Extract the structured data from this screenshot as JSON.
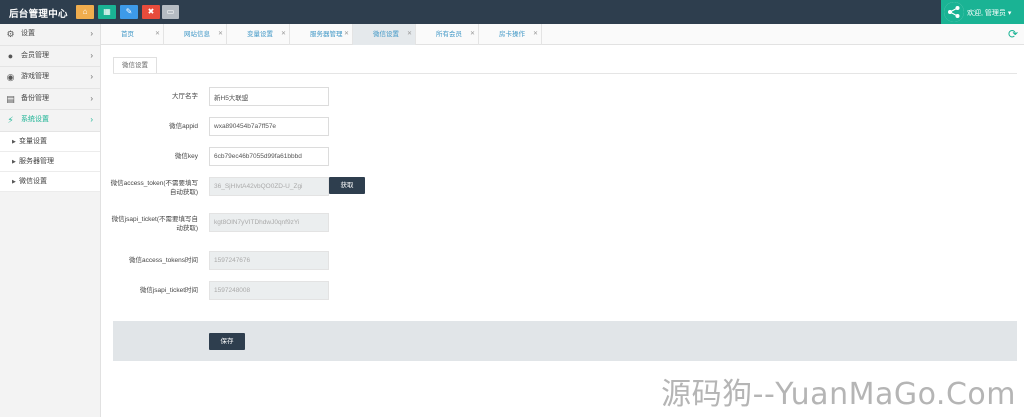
{
  "app": {
    "title": "后台管理中心"
  },
  "toolbar": [
    {
      "icon": "home-icon",
      "glyph": "⌂",
      "color": "#f0ad4e"
    },
    {
      "icon": "grid-icon",
      "glyph": "▦",
      "color": "#1ab394"
    },
    {
      "icon": "edit-icon",
      "glyph": "✎",
      "color": "#3d9ae8"
    },
    {
      "icon": "delete-icon",
      "glyph": "✖",
      "color": "#e74c3c"
    },
    {
      "icon": "window-icon",
      "glyph": "▭",
      "color": "#b5bcc3"
    }
  ],
  "user": {
    "welcome": "欢迎, 管理员 ▾"
  },
  "sidebar": {
    "items": [
      {
        "label": "设置",
        "icon": "gear-icon",
        "glyph": "⚙"
      },
      {
        "label": "会员管理",
        "icon": "users-icon",
        "glyph": "👥"
      },
      {
        "label": "游戏管理",
        "icon": "soccer-icon",
        "glyph": "⚽"
      },
      {
        "label": "备份管理",
        "icon": "backup-icon",
        "glyph": "▤"
      },
      {
        "label": "系统设置",
        "icon": "plug-icon",
        "glyph": "⚡"
      }
    ],
    "subitems": [
      "变量设置",
      "服务器管理",
      "微信设置"
    ]
  },
  "tabs": [
    "首页",
    "网站信息",
    "变量设置",
    "服务器管理",
    "微信设置",
    "所有会员",
    "房卡操作"
  ],
  "panel": {
    "tab_label": "微信设置"
  },
  "form": {
    "hall_name": {
      "label": "大厅名字",
      "value": "新H5大联盟"
    },
    "appid": {
      "label": "微信appid",
      "value": "wxa890454b7a7ff57e"
    },
    "key": {
      "label": "微信key",
      "value": "6cb79ec46b7055d99fa61bbbd"
    },
    "access_token": {
      "label": "微信access_token(不需要填写自动获取)",
      "value": "36_SjHIvtA42vbQO0ZD-U_Zgi"
    },
    "fetch_button": "获取",
    "jsapi_ticket": {
      "label": "微信jsapi_ticket(不需要填写自动获取)",
      "value": "kgt8OlN7yVITDhdwJ0qnf9zYi"
    },
    "access_tokens_time": {
      "label": "微信access_tokens时间",
      "value": "1597247676"
    },
    "jsapi_ticket_time": {
      "label": "微信jsapi_ticket时间",
      "value": "1597248008"
    },
    "save_button": "保存"
  },
  "watermark": "源码狗--YuanMaGo.Com"
}
